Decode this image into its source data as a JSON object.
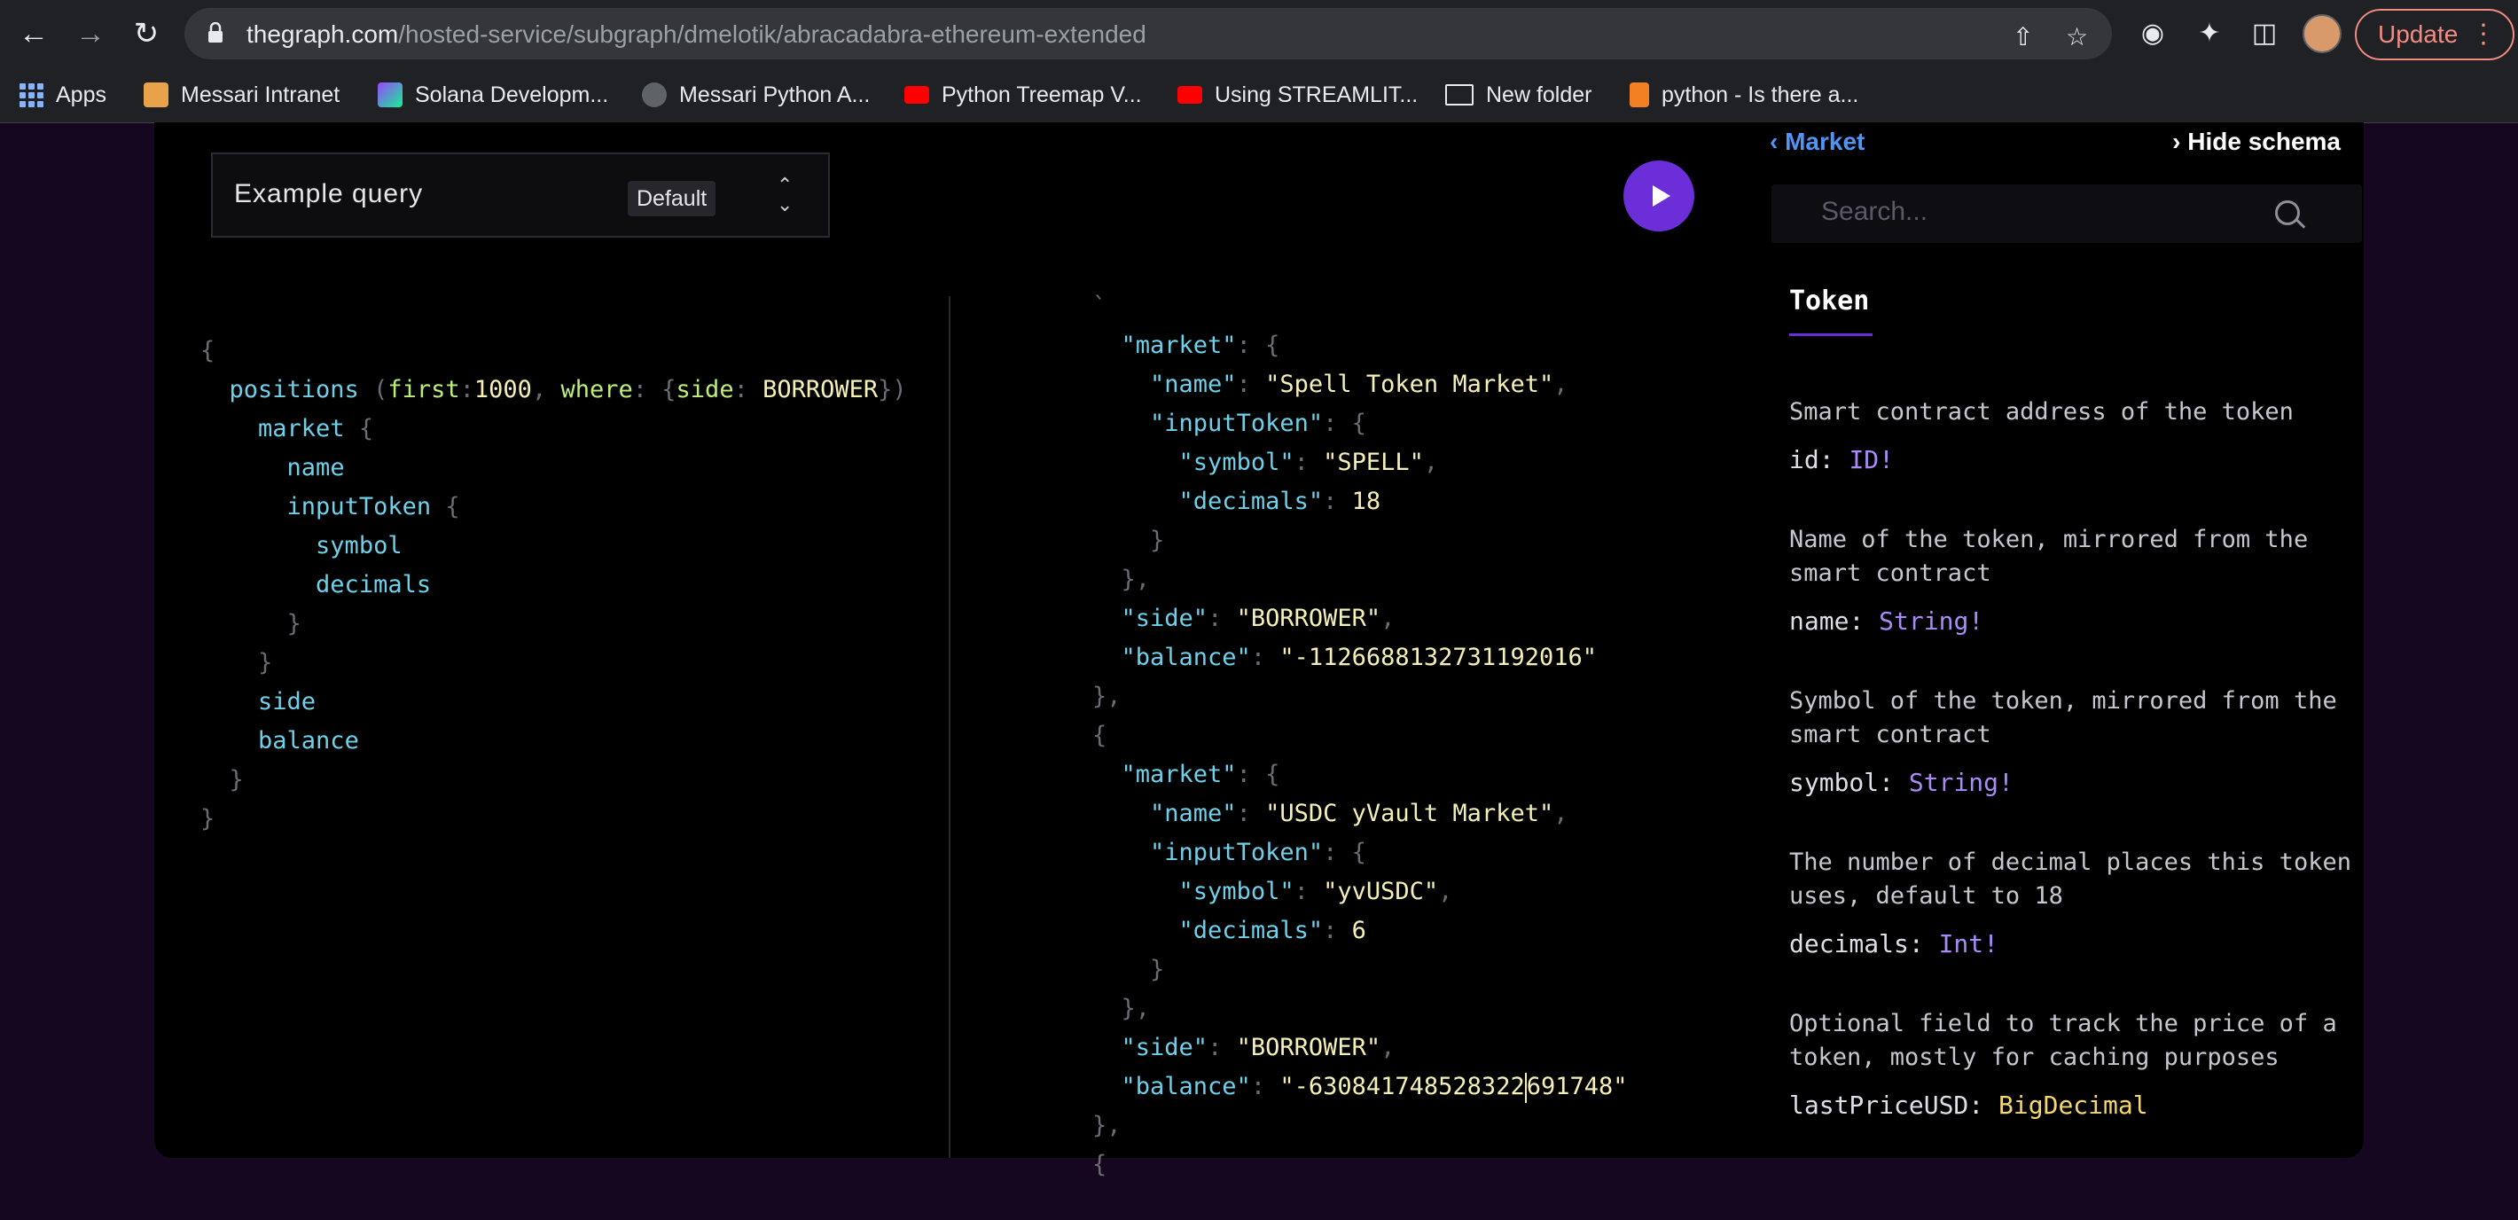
{
  "browser": {
    "url_host": "thegraph.com",
    "url_path": "/hosted-service/subgraph/dmelotik/abracadabra-ethereum-extended",
    "update_label": "Update",
    "bookmarks": [
      {
        "label": "Apps",
        "icon": "apps-grid-icon"
      },
      {
        "label": "Messari Intranet",
        "icon": "house-icon"
      },
      {
        "label": "Solana Developm...",
        "icon": "solana-icon"
      },
      {
        "label": "Messari Python A...",
        "icon": "globe-icon"
      },
      {
        "label": "Python Treemap V...",
        "icon": "youtube-icon"
      },
      {
        "label": "Using STREAMLIT...",
        "icon": "youtube-icon"
      },
      {
        "label": "New folder",
        "icon": "folder-icon"
      },
      {
        "label": "python - Is there a...",
        "icon": "stackoverflow-icon"
      }
    ]
  },
  "query_selector": {
    "label": "Example query",
    "badge": "Default"
  },
  "query_editor": {
    "l1": "{",
    "positions": "positions",
    "open_paren": "(",
    "first": "first",
    "colon1": ":",
    "first_val": "1000",
    "comma": ",",
    "where": "where",
    "colon2": ":",
    "open_brace": "{",
    "side_arg": "side",
    "colon3": ":",
    "side_val": "BORROWER",
    "close": "})",
    "market": "market",
    "market_brace": "{",
    "name": "name",
    "inputToken": "inputToken",
    "it_brace": "{",
    "symbol": "symbol",
    "decimals": "decimals",
    "close_it": "}",
    "close_market": "}",
    "side": "side",
    "balance": "balance",
    "close_positions": "}",
    "close_root": "}"
  },
  "result": {
    "top_fragment": "`",
    "k_market": "\"market\"",
    "k_name": "\"name\"",
    "k_inputToken": "\"inputToken\"",
    "k_symbol": "\"symbol\"",
    "k_decimals": "\"decimals\"",
    "k_side": "\"side\"",
    "k_balance": "\"balance\"",
    "colon": ":",
    "open": "{",
    "comma": ",",
    "close": "}",
    "close_comma": "},",
    "item1": {
      "name": "\"Spell Token Market\"",
      "symbol": "\"SPELL\"",
      "decimals": "18",
      "side": "\"BORROWER\"",
      "balance": "\"-1126688132731192016\""
    },
    "item2": {
      "name": "\"USDC yVault Market\"",
      "symbol": "\"yvUSDC\"",
      "decimals": "6",
      "side": "\"BORROWER\"",
      "balance_a": "\"-630841748528322",
      "balance_b": "691748\""
    }
  },
  "schema": {
    "back_label": "Market",
    "hide_label": "Hide schema",
    "search_placeholder": "Search...",
    "type_title": "Token",
    "fields": [
      {
        "desc": "Smart contract address of the token",
        "name": "id",
        "type": "ID!"
      },
      {
        "desc": "Name of the token, mirrored from the smart contract",
        "name": "name",
        "type": "String!"
      },
      {
        "desc": "Symbol of the token, mirrored from the smart contract",
        "name": "symbol",
        "type": "String!"
      },
      {
        "desc": "The number of decimal places this token uses, default to 18",
        "name": "decimals",
        "type": "Int!"
      },
      {
        "desc": "Optional field to track the price of a token, mostly for caching purposes",
        "name": "lastPriceUSD",
        "type": "BigDecimal"
      }
    ]
  }
}
